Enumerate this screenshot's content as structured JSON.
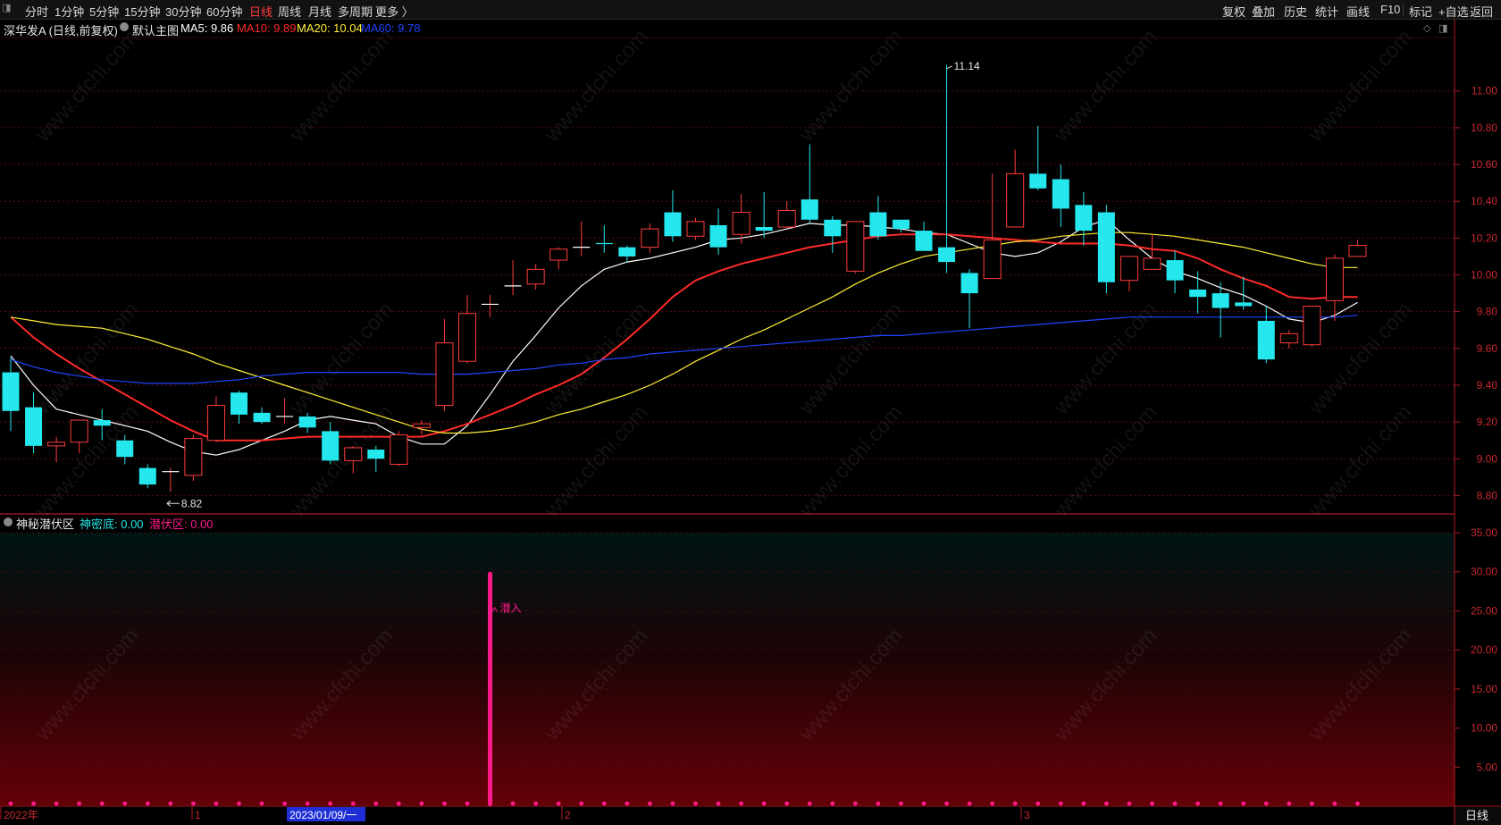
{
  "toolbar": {
    "left": [
      "分时",
      "1分钟",
      "5分钟",
      "15分钟",
      "30分钟",
      "60分钟",
      "日线",
      "周线",
      "月线",
      "多周期",
      "更多 〉"
    ],
    "active": "日线",
    "right": [
      "复权",
      "叠加",
      "历史",
      "统计",
      "画线",
      "F10",
      "+自选",
      "返回"
    ],
    "right_after_sep": "标记"
  },
  "main_panel": {
    "stock": "深华发A (日线,前复权)",
    "template_label": "默认主图",
    "ma": [
      {
        "label": "MA5: 9.86",
        "color": "#ffffff"
      },
      {
        "label": "MA10: 9.89",
        "color": "#ff2a2a"
      },
      {
        "label": "MA20: 10.04",
        "color": "#ffee33"
      },
      {
        "label": "MA60: 9.78",
        "color": "#2244ff"
      }
    ],
    "high_marker": "11.14",
    "low_marker": "8.82"
  },
  "sub_panel": {
    "title": "神秘潜伏区",
    "ind1": "神密底: 0.00",
    "ind2": "潜伏区: 0.00",
    "signal_label": "潜入"
  },
  "x_axis": {
    "labels": [
      "2022年",
      "1",
      "2023/01/09/一",
      "2",
      "3"
    ],
    "period_button": "日线"
  },
  "watermark": "www.cfchi.com",
  "chart_data": [
    {
      "type": "candlestick",
      "ylim": [
        8.7,
        11.3
      ],
      "yticks": [
        8.8,
        9.0,
        9.2,
        9.4,
        9.6,
        9.8,
        10.0,
        10.2,
        10.4,
        10.6,
        10.8,
        11.0
      ],
      "candles": [
        {
          "o": 9.47,
          "h": 9.55,
          "l": 9.15,
          "c": 9.26
        },
        {
          "o": 9.28,
          "h": 9.36,
          "l": 9.03,
          "c": 9.07
        },
        {
          "o": 9.07,
          "h": 9.12,
          "l": 8.98,
          "c": 9.09
        },
        {
          "o": 9.09,
          "h": 9.21,
          "l": 9.03,
          "c": 9.21
        },
        {
          "o": 9.21,
          "h": 9.27,
          "l": 9.1,
          "c": 9.18
        },
        {
          "o": 9.1,
          "h": 9.13,
          "l": 8.97,
          "c": 9.01
        },
        {
          "o": 8.95,
          "h": 8.97,
          "l": 8.84,
          "c": 8.86
        },
        {
          "o": 8.92,
          "h": 8.95,
          "l": 8.82,
          "c": 8.93
        },
        {
          "o": 8.91,
          "h": 9.13,
          "l": 8.88,
          "c": 9.11
        },
        {
          "o": 9.1,
          "h": 9.34,
          "l": 9.09,
          "c": 9.29
        },
        {
          "o": 9.36,
          "h": 9.37,
          "l": 9.19,
          "c": 9.24
        },
        {
          "o": 9.25,
          "h": 9.28,
          "l": 9.19,
          "c": 9.2
        },
        {
          "o": 9.22,
          "h": 9.33,
          "l": 9.19,
          "c": 9.23
        },
        {
          "o": 9.23,
          "h": 9.25,
          "l": 9.14,
          "c": 9.17
        },
        {
          "o": 9.15,
          "h": 9.2,
          "l": 8.97,
          "c": 8.99
        },
        {
          "o": 8.99,
          "h": 9.07,
          "l": 8.92,
          "c": 9.06
        },
        {
          "o": 9.05,
          "h": 9.07,
          "l": 8.93,
          "c": 9.0
        },
        {
          "o": 8.97,
          "h": 9.15,
          "l": 8.96,
          "c": 9.13
        },
        {
          "o": 9.17,
          "h": 9.21,
          "l": 9.13,
          "c": 9.19
        },
        {
          "o": 9.29,
          "h": 9.76,
          "l": 9.26,
          "c": 9.63
        },
        {
          "o": 9.53,
          "h": 9.89,
          "l": 9.52,
          "c": 9.79
        },
        {
          "o": 9.83,
          "h": 9.89,
          "l": 9.77,
          "c": 9.84
        },
        {
          "o": 9.94,
          "h": 10.08,
          "l": 9.89,
          "c": 9.94
        },
        {
          "o": 9.95,
          "h": 10.06,
          "l": 9.92,
          "c": 10.03
        },
        {
          "o": 10.08,
          "h": 10.15,
          "l": 10.03,
          "c": 10.14
        },
        {
          "o": 10.14,
          "h": 10.29,
          "l": 10.1,
          "c": 10.15
        },
        {
          "o": 10.17,
          "h": 10.27,
          "l": 10.12,
          "c": 10.16
        },
        {
          "o": 10.15,
          "h": 10.16,
          "l": 10.07,
          "c": 10.1
        },
        {
          "o": 10.15,
          "h": 10.28,
          "l": 10.12,
          "c": 10.25
        },
        {
          "o": 10.34,
          "h": 10.46,
          "l": 10.18,
          "c": 10.21
        },
        {
          "o": 10.21,
          "h": 10.31,
          "l": 10.19,
          "c": 10.29
        },
        {
          "o": 10.27,
          "h": 10.36,
          "l": 10.11,
          "c": 10.15
        },
        {
          "o": 10.22,
          "h": 10.44,
          "l": 10.17,
          "c": 10.34
        },
        {
          "o": 10.26,
          "h": 10.45,
          "l": 10.2,
          "c": 10.24
        },
        {
          "o": 10.26,
          "h": 10.4,
          "l": 10.25,
          "c": 10.35
        },
        {
          "o": 10.41,
          "h": 10.71,
          "l": 10.28,
          "c": 10.3
        },
        {
          "o": 10.3,
          "h": 10.32,
          "l": 10.12,
          "c": 10.21
        },
        {
          "o": 10.02,
          "h": 10.29,
          "l": 10.01,
          "c": 10.29
        },
        {
          "o": 10.34,
          "h": 10.43,
          "l": 10.19,
          "c": 10.21
        },
        {
          "o": 10.3,
          "h": 10.3,
          "l": 10.23,
          "c": 10.25
        },
        {
          "o": 10.24,
          "h": 10.29,
          "l": 10.13,
          "c": 10.13
        },
        {
          "o": 10.15,
          "h": 11.14,
          "l": 10.01,
          "c": 10.07
        },
        {
          "o": 10.01,
          "h": 10.03,
          "l": 9.71,
          "c": 9.9
        },
        {
          "o": 9.98,
          "h": 10.55,
          "l": 9.98,
          "c": 10.19
        },
        {
          "o": 10.26,
          "h": 10.68,
          "l": 10.26,
          "c": 10.55
        },
        {
          "o": 10.55,
          "h": 10.81,
          "l": 10.46,
          "c": 10.47
        },
        {
          "o": 10.52,
          "h": 10.6,
          "l": 10.26,
          "c": 10.36
        },
        {
          "o": 10.38,
          "h": 10.45,
          "l": 10.16,
          "c": 10.24
        },
        {
          "o": 10.34,
          "h": 10.38,
          "l": 9.9,
          "c": 9.96
        },
        {
          "o": 9.97,
          "h": 10.1,
          "l": 9.91,
          "c": 10.1
        },
        {
          "o": 10.03,
          "h": 10.22,
          "l": 10.03,
          "c": 10.09
        },
        {
          "o": 10.08,
          "h": 10.13,
          "l": 9.9,
          "c": 9.97
        },
        {
          "o": 9.92,
          "h": 10.02,
          "l": 9.79,
          "c": 9.88
        },
        {
          "o": 9.9,
          "h": 9.96,
          "l": 9.66,
          "c": 9.82
        },
        {
          "o": 9.85,
          "h": 9.99,
          "l": 9.81,
          "c": 9.83
        },
        {
          "o": 9.75,
          "h": 9.83,
          "l": 9.52,
          "c": 9.54
        },
        {
          "o": 9.63,
          "h": 9.7,
          "l": 9.6,
          "c": 9.68
        },
        {
          "o": 9.62,
          "h": 9.83,
          "l": 9.61,
          "c": 9.83
        },
        {
          "o": 9.86,
          "h": 10.11,
          "l": 9.75,
          "c": 10.09
        },
        {
          "o": 10.1,
          "h": 10.19,
          "l": 10.1,
          "c": 10.16
        }
      ],
      "series": [
        {
          "name": "MA5",
          "color": "#ffffff",
          "values": [
            9.56,
            9.4,
            9.27,
            9.24,
            9.21,
            9.18,
            9.15,
            9.09,
            9.04,
            9.02,
            9.05,
            9.1,
            9.15,
            9.21,
            9.23,
            9.21,
            9.19,
            9.12,
            9.08,
            9.08,
            9.18,
            9.35,
            9.53,
            9.67,
            9.82,
            9.94,
            10.03,
            10.07,
            10.09,
            10.12,
            10.15,
            10.19,
            10.2,
            10.22,
            10.25,
            10.28,
            10.27,
            10.27,
            10.26,
            10.25,
            10.23,
            10.22,
            10.17,
            10.12,
            10.1,
            10.12,
            10.18,
            10.26,
            10.3,
            10.19,
            10.09,
            10.02,
            9.98,
            9.93,
            9.89,
            9.83,
            9.76,
            9.74,
            9.78,
            9.85
          ]
        },
        {
          "name": "MA10",
          "color": "#ff2a2a",
          "values": [
            9.77,
            9.66,
            9.57,
            9.49,
            9.42,
            9.35,
            9.28,
            9.21,
            9.15,
            9.1,
            9.1,
            9.1,
            9.11,
            9.12,
            9.12,
            9.12,
            9.12,
            9.12,
            9.12,
            9.15,
            9.19,
            9.24,
            9.29,
            9.35,
            9.4,
            9.46,
            9.55,
            9.65,
            9.76,
            9.88,
            9.97,
            10.02,
            10.06,
            10.09,
            10.12,
            10.15,
            10.17,
            10.19,
            10.21,
            10.22,
            10.22,
            10.22,
            10.21,
            10.2,
            10.19,
            10.18,
            10.17,
            10.17,
            10.17,
            10.16,
            10.14,
            10.13,
            10.09,
            10.03,
            9.98,
            9.94,
            9.88,
            9.87,
            9.88,
            9.88
          ]
        },
        {
          "name": "MA20",
          "color": "#ffee33",
          "values": [
            9.77,
            9.75,
            9.73,
            9.72,
            9.71,
            9.68,
            9.65,
            9.61,
            9.57,
            9.52,
            9.48,
            9.44,
            9.4,
            9.36,
            9.32,
            9.28,
            9.24,
            9.2,
            9.16,
            9.14,
            9.14,
            9.15,
            9.17,
            9.2,
            9.24,
            9.27,
            9.31,
            9.35,
            9.4,
            9.46,
            9.53,
            9.59,
            9.65,
            9.7,
            9.76,
            9.82,
            9.88,
            9.95,
            10.01,
            10.06,
            10.1,
            10.12,
            10.14,
            10.16,
            10.18,
            10.19,
            10.21,
            10.22,
            10.23,
            10.23,
            10.22,
            10.21,
            10.19,
            10.17,
            10.15,
            10.12,
            10.09,
            10.06,
            10.04,
            10.04
          ]
        },
        {
          "name": "MA60",
          "color": "#2244ff",
          "values": [
            9.54,
            9.5,
            9.47,
            9.45,
            9.43,
            9.42,
            9.41,
            9.41,
            9.41,
            9.42,
            9.43,
            9.45,
            9.46,
            9.47,
            9.47,
            9.47,
            9.47,
            9.47,
            9.46,
            9.46,
            9.46,
            9.47,
            9.48,
            9.49,
            9.51,
            9.52,
            9.54,
            9.55,
            9.57,
            9.58,
            9.59,
            9.6,
            9.61,
            9.62,
            9.63,
            9.64,
            9.65,
            9.66,
            9.67,
            9.67,
            9.68,
            9.69,
            9.7,
            9.71,
            9.72,
            9.73,
            9.74,
            9.75,
            9.76,
            9.77,
            9.77,
            9.77,
            9.77,
            9.77,
            9.77,
            9.77,
            9.77,
            9.77,
            9.77,
            9.78
          ]
        }
      ]
    },
    {
      "type": "bar",
      "ylim": [
        0,
        35
      ],
      "yticks": [
        5,
        10,
        15,
        20,
        25,
        30,
        35
      ],
      "series": [
        {
          "name": "神密底",
          "color": "#ff1a8c",
          "values": [
            0,
            0,
            0,
            0,
            0,
            0,
            0,
            0,
            0,
            0,
            0,
            0,
            0,
            0,
            0,
            0,
            0,
            0,
            0,
            0,
            0,
            30,
            0,
            0,
            0,
            0,
            0,
            0,
            0,
            0,
            0,
            0,
            0,
            0,
            0,
            0,
            0,
            0,
            0,
            0,
            0,
            0,
            0,
            0,
            0,
            0,
            0,
            0,
            0,
            0,
            0,
            0,
            0,
            0,
            0,
            0,
            0,
            0,
            0,
            0
          ]
        }
      ]
    }
  ]
}
